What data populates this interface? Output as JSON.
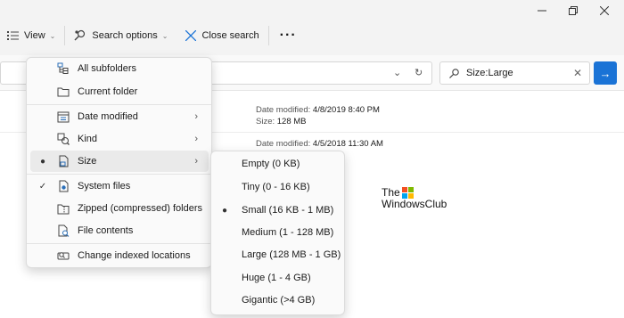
{
  "toolbar": {
    "view_label": "View",
    "search_options_label": "Search options",
    "close_search_label": "Close search"
  },
  "search": {
    "value": "Size:Large"
  },
  "files": [
    {
      "date_label": "Date modified:",
      "date_value": "4/8/2019 8:40 PM",
      "size_label": "Size:",
      "size_value": "128 MB"
    },
    {
      "date_label": "Date modified:",
      "date_value": "4/5/2018 11:30 AM"
    }
  ],
  "view_menu": {
    "items": [
      {
        "label": "All subfolders",
        "icon": "subfolders-icon"
      },
      {
        "label": "Current folder",
        "icon": "folder-icon"
      },
      {
        "label": "Date modified",
        "icon": "calendar-icon",
        "has_submenu": true
      },
      {
        "label": "Kind",
        "icon": "kind-icon",
        "has_submenu": true
      },
      {
        "label": "Size",
        "icon": "file-size-icon",
        "has_submenu": true,
        "selected": true
      },
      {
        "label": "System files",
        "icon": "system-file-icon",
        "checked": true
      },
      {
        "label": "Zipped (compressed) folders",
        "icon": "zip-folder-icon"
      },
      {
        "label": "File contents",
        "icon": "file-contents-icon"
      },
      {
        "label": "Change indexed locations",
        "icon": "index-locations-icon"
      }
    ]
  },
  "size_menu": {
    "items": [
      {
        "label": "Empty (0 KB)"
      },
      {
        "label": "Tiny (0 - 16 KB)"
      },
      {
        "label": "Small (16 KB - 1 MB)",
        "selected": true
      },
      {
        "label": "Medium (1 - 128 MB)"
      },
      {
        "label": "Large (128 MB - 1 GB)"
      },
      {
        "label": "Huge (1 - 4 GB)"
      },
      {
        "label": "Gigantic (>4 GB)"
      }
    ]
  },
  "logo": {
    "line1": "The",
    "line2": "WindowsClub"
  },
  "colors": {
    "accent": "#1a73d6"
  }
}
